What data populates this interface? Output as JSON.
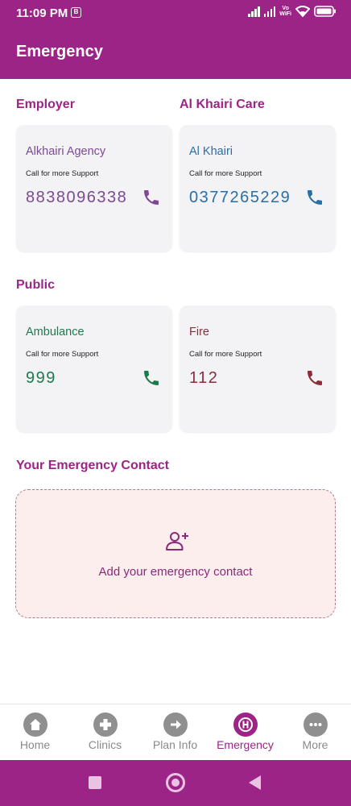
{
  "status_bar": {
    "time": "11:09 PM",
    "volte": "Vo\nWiFi"
  },
  "header": {
    "title": "Emergency"
  },
  "sections": {
    "employer": "Employer",
    "care": "Al Khairi Care",
    "public": "Public",
    "own": "Your Emergency Contact"
  },
  "cards": [
    {
      "name": "Alkhairi Agency",
      "subtitle": "Call for more Support",
      "number": "8838096338",
      "color": "#7b4a93"
    },
    {
      "name": "Al Khairi",
      "subtitle": "Call for more Support",
      "number": "0377265229",
      "color": "#2a6ea6"
    },
    {
      "name": "Ambulance",
      "subtitle": "Call for more Support",
      "number": "999",
      "color": "#1e7a4e"
    },
    {
      "name": "Fire",
      "subtitle": "Call for more Support",
      "number": "112",
      "color": "#8b2e3a"
    }
  ],
  "emergency_contact": {
    "add_label": "Add your emergency contact",
    "icon": "add-person-icon"
  },
  "bottom_nav": [
    {
      "label": "Home",
      "icon": "home-icon"
    },
    {
      "label": "Clinics",
      "icon": "plus-icon"
    },
    {
      "label": "Plan Info",
      "icon": "arrow-right-icon"
    },
    {
      "label": "Emergency",
      "icon": "hospital-icon",
      "active": true
    },
    {
      "label": "More",
      "icon": "more-icon"
    }
  ],
  "colors": {
    "brand": "#9c2487",
    "nav_inactive": "#8f8f8f"
  }
}
